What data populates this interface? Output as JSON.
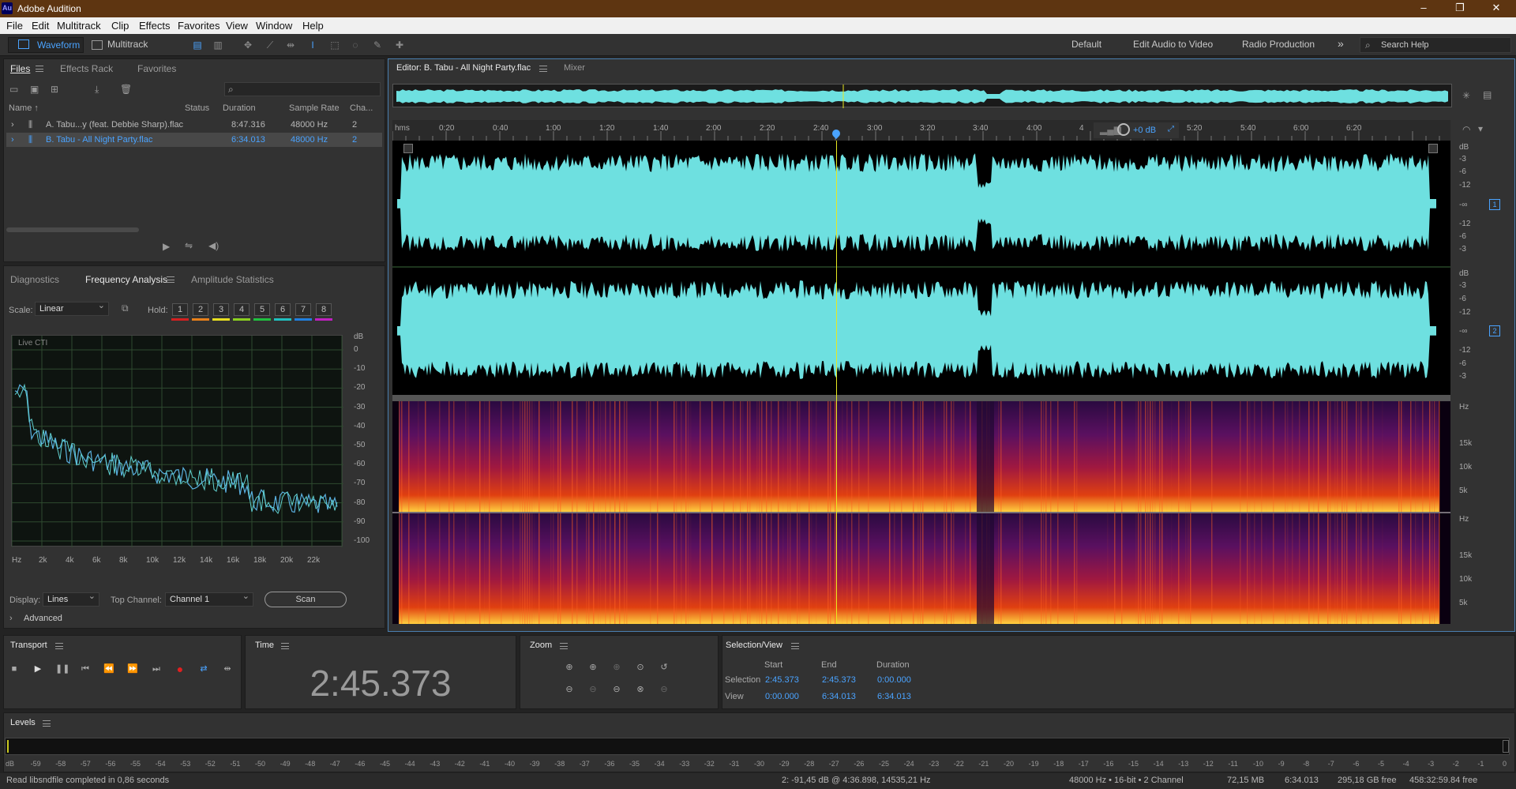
{
  "app": {
    "title": "Adobe Audition",
    "logo": "Au"
  },
  "window_controls": {
    "minimize": "–",
    "maximize": "❐",
    "close": "✕"
  },
  "menu": [
    "File",
    "Edit",
    "Multitrack",
    "Clip",
    "Effects",
    "Favorites",
    "View",
    "Window",
    "Help"
  ],
  "toolbar": {
    "waveform": "Waveform",
    "multitrack": "Multitrack"
  },
  "workspaces": {
    "default": "Default",
    "edit_audio_video": "Edit Audio to Video",
    "radio": "Radio Production",
    "more": "»",
    "search": "Search Help"
  },
  "files_panel": {
    "tabs": [
      "Files",
      "Effects Rack",
      "Favorites"
    ],
    "columns": {
      "name": "Name ↑",
      "status": "Status",
      "duration": "Duration",
      "sample_rate": "Sample Rate",
      "channels": "Cha..."
    },
    "rows": [
      {
        "name": "A. Tabu...y (feat. Debbie Sharp).flac",
        "duration": "8:47.316",
        "rate": "48000 Hz",
        "ch": "2"
      },
      {
        "name": "B. Tabu - All Night Party.flac",
        "duration": "6:34.013",
        "rate": "48000 Hz",
        "ch": "2"
      }
    ]
  },
  "analysis_panel": {
    "tabs": [
      "Diagnostics",
      "Frequency Analysis",
      "Amplitude Statistics"
    ],
    "scale_label": "Scale:",
    "scale_value": "Linear",
    "hold_label": "Hold:",
    "hold": [
      "1",
      "2",
      "3",
      "4",
      "5",
      "6",
      "7",
      "8"
    ],
    "hold_colors": [
      "#d42020",
      "#e8801a",
      "#e8e020",
      "#8cd020",
      "#20c040",
      "#20c0c0",
      "#2080e0",
      "#c020c0"
    ],
    "live_cti": "Live CTI",
    "db_label": "dB",
    "db_ticks": [
      "0",
      "-10",
      "-20",
      "-30",
      "-40",
      "-50",
      "-60",
      "-70",
      "-80",
      "-90",
      "-100"
    ],
    "hz_ticks": [
      "Hz",
      "2k",
      "4k",
      "6k",
      "8k",
      "10k",
      "12k",
      "14k",
      "16k",
      "18k",
      "20k",
      "22k"
    ],
    "display_label": "Display:",
    "display_value": "Lines",
    "top_channel_label": "Top Channel:",
    "top_channel_value": "Channel 1",
    "scan": "Scan",
    "advanced": "Advanced"
  },
  "editor": {
    "tab": "Editor: B. Tabu - All Night Party.flac",
    "mixer": "Mixer",
    "ruler": [
      "hms",
      "0:20",
      "0:40",
      "1:00",
      "1:20",
      "1:40",
      "2:00",
      "2:20",
      "2:40",
      "3:00",
      "3:20",
      "3:40",
      "4:00",
      "4",
      "5:00",
      "5:20",
      "5:40",
      "6:00",
      "6:20"
    ],
    "hud": "+0 dB",
    "db_scale": [
      "dB",
      "-3",
      "-6",
      "-12",
      "-∞",
      "-12",
      "-6",
      "-3"
    ],
    "db_scale2": [
      "dB",
      "-3",
      "-6",
      "-12",
      "-∞",
      "-12",
      "-6",
      "-3"
    ],
    "ch1": "1",
    "ch2": "2",
    "hz_scale": [
      "Hz",
      "15k",
      "10k",
      "5k"
    ],
    "hz_scale2": [
      "Hz",
      "15k",
      "10k",
      "5k"
    ],
    "waveform_color": "#6ee0e0",
    "playhead_color": "#e8e820"
  },
  "transport": {
    "title": "Transport"
  },
  "time": {
    "title": "Time",
    "value": "2:45.373"
  },
  "zoom": {
    "title": "Zoom"
  },
  "selection": {
    "title": "Selection/View",
    "headers": [
      "Start",
      "End",
      "Duration"
    ],
    "selection_label": "Selection",
    "selection": [
      "2:45.373",
      "2:45.373",
      "0:00.000"
    ],
    "view_label": "View",
    "view": [
      "0:00.000",
      "6:34.013",
      "6:34.013"
    ]
  },
  "levels": {
    "title": "Levels",
    "ticks": [
      "dB",
      "-59",
      "-58",
      "-57",
      "-56",
      "-55",
      "-54",
      "-53",
      "-52",
      "-51",
      "-50",
      "-49",
      "-48",
      "-47",
      "-46",
      "-45",
      "-44",
      "-43",
      "-42",
      "-41",
      "-40",
      "-39",
      "-38",
      "-37",
      "-36",
      "-35",
      "-34",
      "-33",
      "-32",
      "-31",
      "-30",
      "-29",
      "-28",
      "-27",
      "-26",
      "-25",
      "-24",
      "-23",
      "-22",
      "-21",
      "-20",
      "-19",
      "-18",
      "-17",
      "-16",
      "-15",
      "-14",
      "-13",
      "-12",
      "-11",
      "-10",
      "-9",
      "-8",
      "-7",
      "-6",
      "-5",
      "-4",
      "-3",
      "-2",
      "-1",
      "0"
    ]
  },
  "status": {
    "message": "Read libsndfile completed in 0,86 seconds",
    "cursor": "2: -91,45 dB @ 4:36.898, 14535,21 Hz",
    "format": "48000 Hz • 16-bit • 2 Channel",
    "size": "72,15 MB",
    "duration": "6:34.013",
    "free": "295,18 GB free",
    "free_time": "458:32:59.84 free"
  }
}
